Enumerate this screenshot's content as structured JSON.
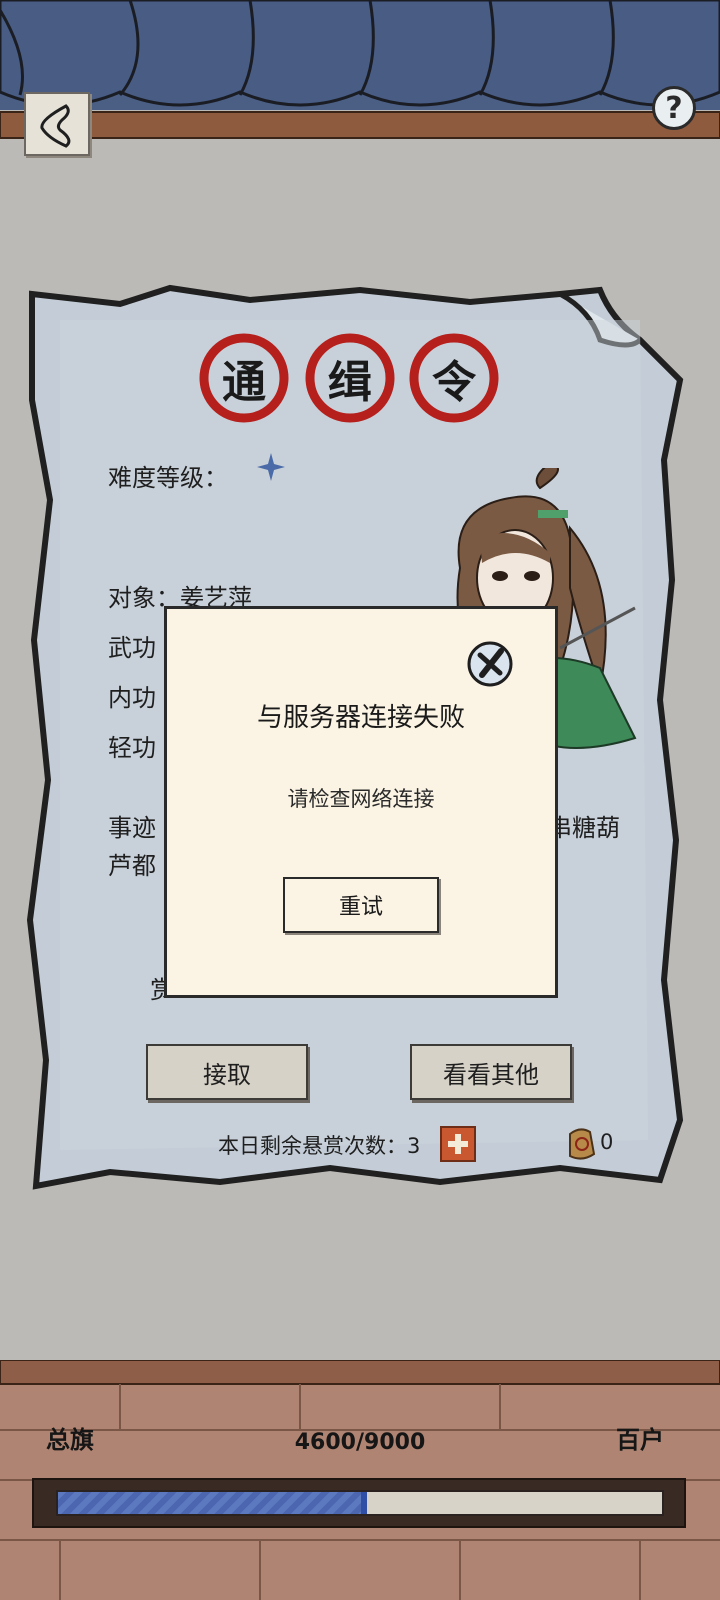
{
  "header": {
    "back_icon": "back-chevron-icon",
    "help_label": "?"
  },
  "notice": {
    "seal_chars": [
      "通",
      "缉",
      "令"
    ],
    "difficulty_label": "难度等级：",
    "difficulty_stars": 1,
    "target_label": "对象：姜艺萍",
    "martial_label": "武功",
    "inner_label": "内功",
    "light_label": "轻功",
    "deeds_line1_start": "事迹",
    "deeds_line1_end": "串糖葫",
    "deeds_line2_start": "芦都",
    "reward_fragment": "赏",
    "accept_label": "接取",
    "other_label": "看看其他",
    "remaining_label": "本日剩余悬赏次数：3",
    "token_count": "0"
  },
  "rank": {
    "current": "总旗",
    "next": "百户",
    "progress_text": "4600/9000",
    "progress": 0.511
  },
  "dialog": {
    "title": "与服务器连接失败",
    "message": "请检查网络连接",
    "retry_label": "重试",
    "close_icon": "close-x-icon"
  },
  "colors": {
    "seal_red": "#b5201c",
    "roof_blue": "#4a5f86",
    "progress_blue": "#4c67b0"
  }
}
